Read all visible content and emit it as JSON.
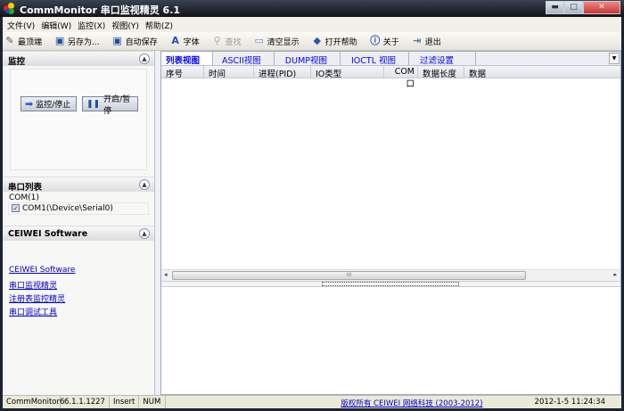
{
  "window": {
    "title": "CommMonitor 串口监视精灵 6.1",
    "minimize": "▬",
    "maximize": "□",
    "close": "✕"
  },
  "menu": [
    "文件(V)",
    "编辑(W)",
    "监控(X)",
    "视图(Y)",
    "帮助(Z)"
  ],
  "toolbar": [
    {
      "label": "最顶端",
      "icon": "pin-icon",
      "glyph": "✎",
      "color": "#555",
      "enabled": true
    },
    {
      "label": "另存为...",
      "icon": "save-icon",
      "glyph": "▣",
      "color": "#1b4fa0",
      "enabled": true
    },
    {
      "label": "自动保存",
      "icon": "autosave-icon",
      "glyph": "▣",
      "color": "#1b4fa0",
      "enabled": true
    },
    {
      "label": "字体",
      "icon": "font-icon",
      "glyph": "A",
      "color": "#1d4fbf",
      "enabled": true
    },
    {
      "label": "查找",
      "icon": "find-icon",
      "glyph": "⚲",
      "color": "#aaa",
      "enabled": false
    },
    {
      "label": "清空显示",
      "icon": "clear-icon",
      "glyph": "▭",
      "color": "#6a8fc0",
      "enabled": true
    },
    {
      "label": "打开帮助",
      "icon": "help-book-icon",
      "glyph": "◆",
      "color": "#2a5aa8",
      "enabled": true
    },
    {
      "label": "关于",
      "icon": "info-icon",
      "glyph": "ⓘ",
      "color": "#1d4fbf",
      "enabled": true
    },
    {
      "label": "退出",
      "icon": "exit-icon",
      "glyph": "⇥",
      "color": "#4a7ac0",
      "enabled": true
    }
  ],
  "left": {
    "monitor": {
      "title": "监控",
      "start_stop": "监控/停止",
      "pause": "开启/暂停"
    },
    "ports": {
      "title": "串口列表",
      "group": "COM(1)",
      "items": [
        {
          "label": "COM1(\\Device\\Serial0)",
          "checked": true
        }
      ]
    },
    "ceiwei": {
      "title": "CEIWEI Software",
      "links": [
        "CEIWEI Software",
        "串口监视精灵",
        "注册表监控精灵",
        "串口调试工具"
      ]
    }
  },
  "tabs": [
    "列表视图",
    "ASCII视图",
    "DUMP视图",
    "IOCTL 视图",
    "过滤设置"
  ],
  "active_tab": 0,
  "columns": [
    "序号",
    "时间",
    "进程(PID)",
    "IO类型",
    "COM口",
    "数据长度",
    "数据"
  ],
  "status": {
    "app": "CommMonitor6",
    "version": "6.1.1.1227",
    "mode": "Insert",
    "num": "NUM",
    "copyright": "版权所有  CEIWEI 网络科技 (2003-2012)",
    "datetime": "2012-1-5 11:24:34"
  }
}
